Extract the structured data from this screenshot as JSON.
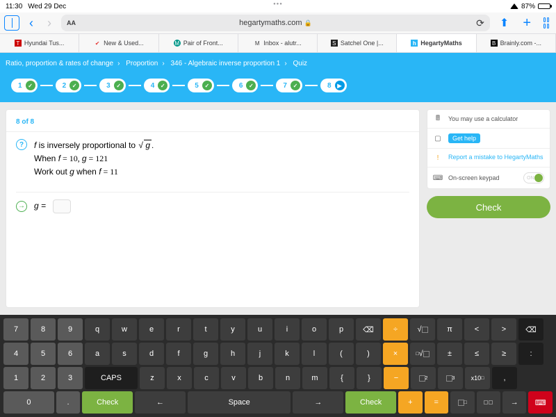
{
  "status": {
    "time": "11:30",
    "date": "Wed 29 Dec",
    "battery_pct": "87%"
  },
  "browser": {
    "url": "hegartymaths.com",
    "aa": "AA",
    "bookmarks": [
      {
        "label": "Hyundai Tus..."
      },
      {
        "label": "New & Used..."
      },
      {
        "label": "Pair of Front..."
      },
      {
        "label": "Inbox - alutr..."
      },
      {
        "label": "Satchel One |..."
      },
      {
        "label": "HegartyMaths"
      },
      {
        "label": "Brainly.com -..."
      }
    ]
  },
  "breadcrumb": {
    "a": "Ratio, proportion & rates of change",
    "b": "Proportion",
    "c": "346 - Algebraic inverse proportion 1",
    "d": "Quiz"
  },
  "progress": {
    "steps": [
      "1",
      "2",
      "3",
      "4",
      "5",
      "6",
      "7",
      "8"
    ]
  },
  "question": {
    "count": "8 of 8",
    "line1_pre": " is inversely proportional to ",
    "line2_pre": "When ",
    "line2_eq": "f = 10, g = 121",
    "line3_pre": "Work out ",
    "line3_mid": " when ",
    "line3_eq": "f = 11",
    "answer_label": "g ="
  },
  "tools": {
    "calc": "You may use a calculator",
    "gethelp": "Get help",
    "report": "Report a mistake to HegartyMaths",
    "keypad": "On-screen keypad",
    "toggle": "ON"
  },
  "check_btn": "Check",
  "keyboard": {
    "r1_nums": [
      "7",
      "8",
      "9"
    ],
    "r1_letters": [
      "q",
      "w",
      "e",
      "r",
      "t",
      "y",
      "u",
      "i",
      "o",
      "p"
    ],
    "r1_ops": [
      "÷",
      "√□",
      "π",
      "<",
      ">"
    ],
    "r2_nums": [
      "4",
      "5",
      "6"
    ],
    "r2_letters": [
      "a",
      "s",
      "d",
      "f",
      "g",
      "h",
      "j",
      "k",
      "l",
      "(",
      ")"
    ],
    "r2_ops": [
      "×",
      "√□",
      "±",
      "≤",
      "≥",
      ":"
    ],
    "r3_nums": [
      "1",
      "2",
      "3"
    ],
    "r3_caps": "CAPS",
    "r3_letters": [
      "z",
      "x",
      "c",
      "v",
      "b",
      "n",
      "m",
      "{",
      "}"
    ],
    "r3_ops": [
      "−",
      "□²",
      "□³",
      "x10□",
      ","
    ],
    "r4_zero": "0",
    "r4_dot": ".",
    "r4_check": "Check",
    "r4_back": "←",
    "r4_space": "Space",
    "r4_fwd": "→",
    "r4_check2": "Check",
    "r4_ops": [
      "+",
      "="
    ]
  }
}
